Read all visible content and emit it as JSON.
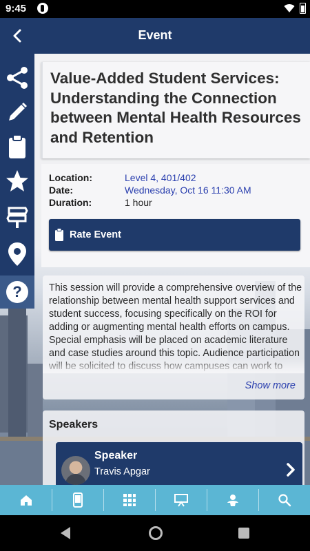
{
  "status_bar": {
    "time": "9:45"
  },
  "app_bar": {
    "title": "Event"
  },
  "side_rail": {
    "icons": [
      "share-icon",
      "pencil-icon",
      "clipboard-icon",
      "star-icon",
      "signpost-icon",
      "map-pin-icon",
      "help-icon"
    ],
    "help_glyph": "?"
  },
  "event": {
    "title": "Value-Added Student Services: Understanding the Connection between Mental Health Resources and Retention",
    "location_label": "Location:",
    "location": "Level 4, 401/402",
    "date_label": "Date:",
    "date": "Wednesday, Oct 16 11:30 AM",
    "duration_label": "Duration:",
    "duration": "1 hour",
    "rate_button": "Rate Event",
    "description": "This session will provide a comprehensive overview of the relationship between mental health support services and student success, focusing specifically on the ROI for adding or augmenting mental health efforts on campus. Special emphasis will be placed on academic literature and case studies around this topic. Audience participation will be solicited to discuss how campuses can work to address these challenges.",
    "show_more": "Show more"
  },
  "speakers": {
    "heading": "Speakers",
    "items": [
      {
        "role": "Speaker",
        "name": "Travis Apgar"
      }
    ]
  },
  "bottom_tabs": [
    "home-icon",
    "phone-icon",
    "grid-icon",
    "presentation-icon",
    "person-icon",
    "search-icon"
  ],
  "colors": {
    "primary": "#1f3a6a",
    "accent_blue": "#2a3fae",
    "tab_bar": "#5bb6d4"
  }
}
